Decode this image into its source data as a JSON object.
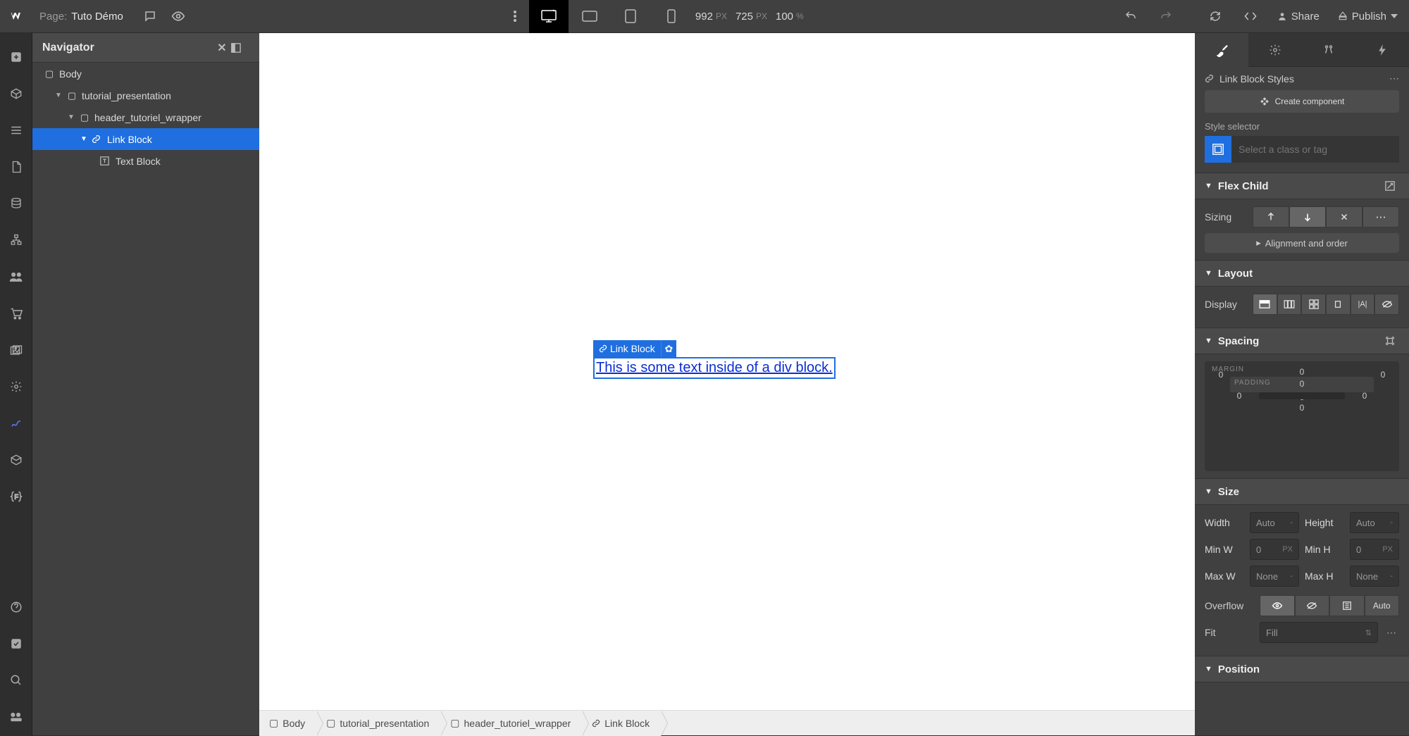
{
  "topbar": {
    "page_label": "Page:",
    "page_name": "Tuto Démo",
    "width": "992",
    "width_unit": "PX",
    "height": "725",
    "height_unit": "PX",
    "zoom": "100",
    "zoom_unit": "%",
    "share": "Share",
    "publish": "Publish"
  },
  "navigator": {
    "title": "Navigator",
    "tree": {
      "body": "Body",
      "section": "tutorial_presentation",
      "wrapper": "header_tutoriel_wrapper",
      "link_block": "Link Block",
      "text_block": "Text Block"
    }
  },
  "canvas": {
    "selection_label": "Link Block",
    "link_text": "This is some text inside of a div block."
  },
  "breadcrumb": {
    "body": "Body",
    "section": "tutorial_presentation",
    "wrapper": "header_tutoriel_wrapper",
    "link_block": "Link Block"
  },
  "right": {
    "styles_title": "Link Block Styles",
    "create_component": "Create component",
    "style_selector_label": "Style selector",
    "style_selector_placeholder": "Select a class or tag",
    "flex_child": "Flex Child",
    "sizing_label": "Sizing",
    "alignment_order": "Alignment and order",
    "layout": "Layout",
    "display_label": "Display",
    "spacing": "Spacing",
    "margin_label": "MARGIN",
    "padding_label": "PADDING",
    "sp_val": "0",
    "size": "Size",
    "width_label": "Width",
    "height_label": "Height",
    "minw_label": "Min W",
    "minh_label": "Min H",
    "maxw_label": "Max W",
    "maxh_label": "Max H",
    "auto": "Auto",
    "zero": "0",
    "px": "PX",
    "none": "None",
    "dash": "-",
    "overflow_label": "Overflow",
    "overflow_auto": "Auto",
    "fit_label": "Fit",
    "fit_value": "Fill",
    "position": "Position"
  }
}
